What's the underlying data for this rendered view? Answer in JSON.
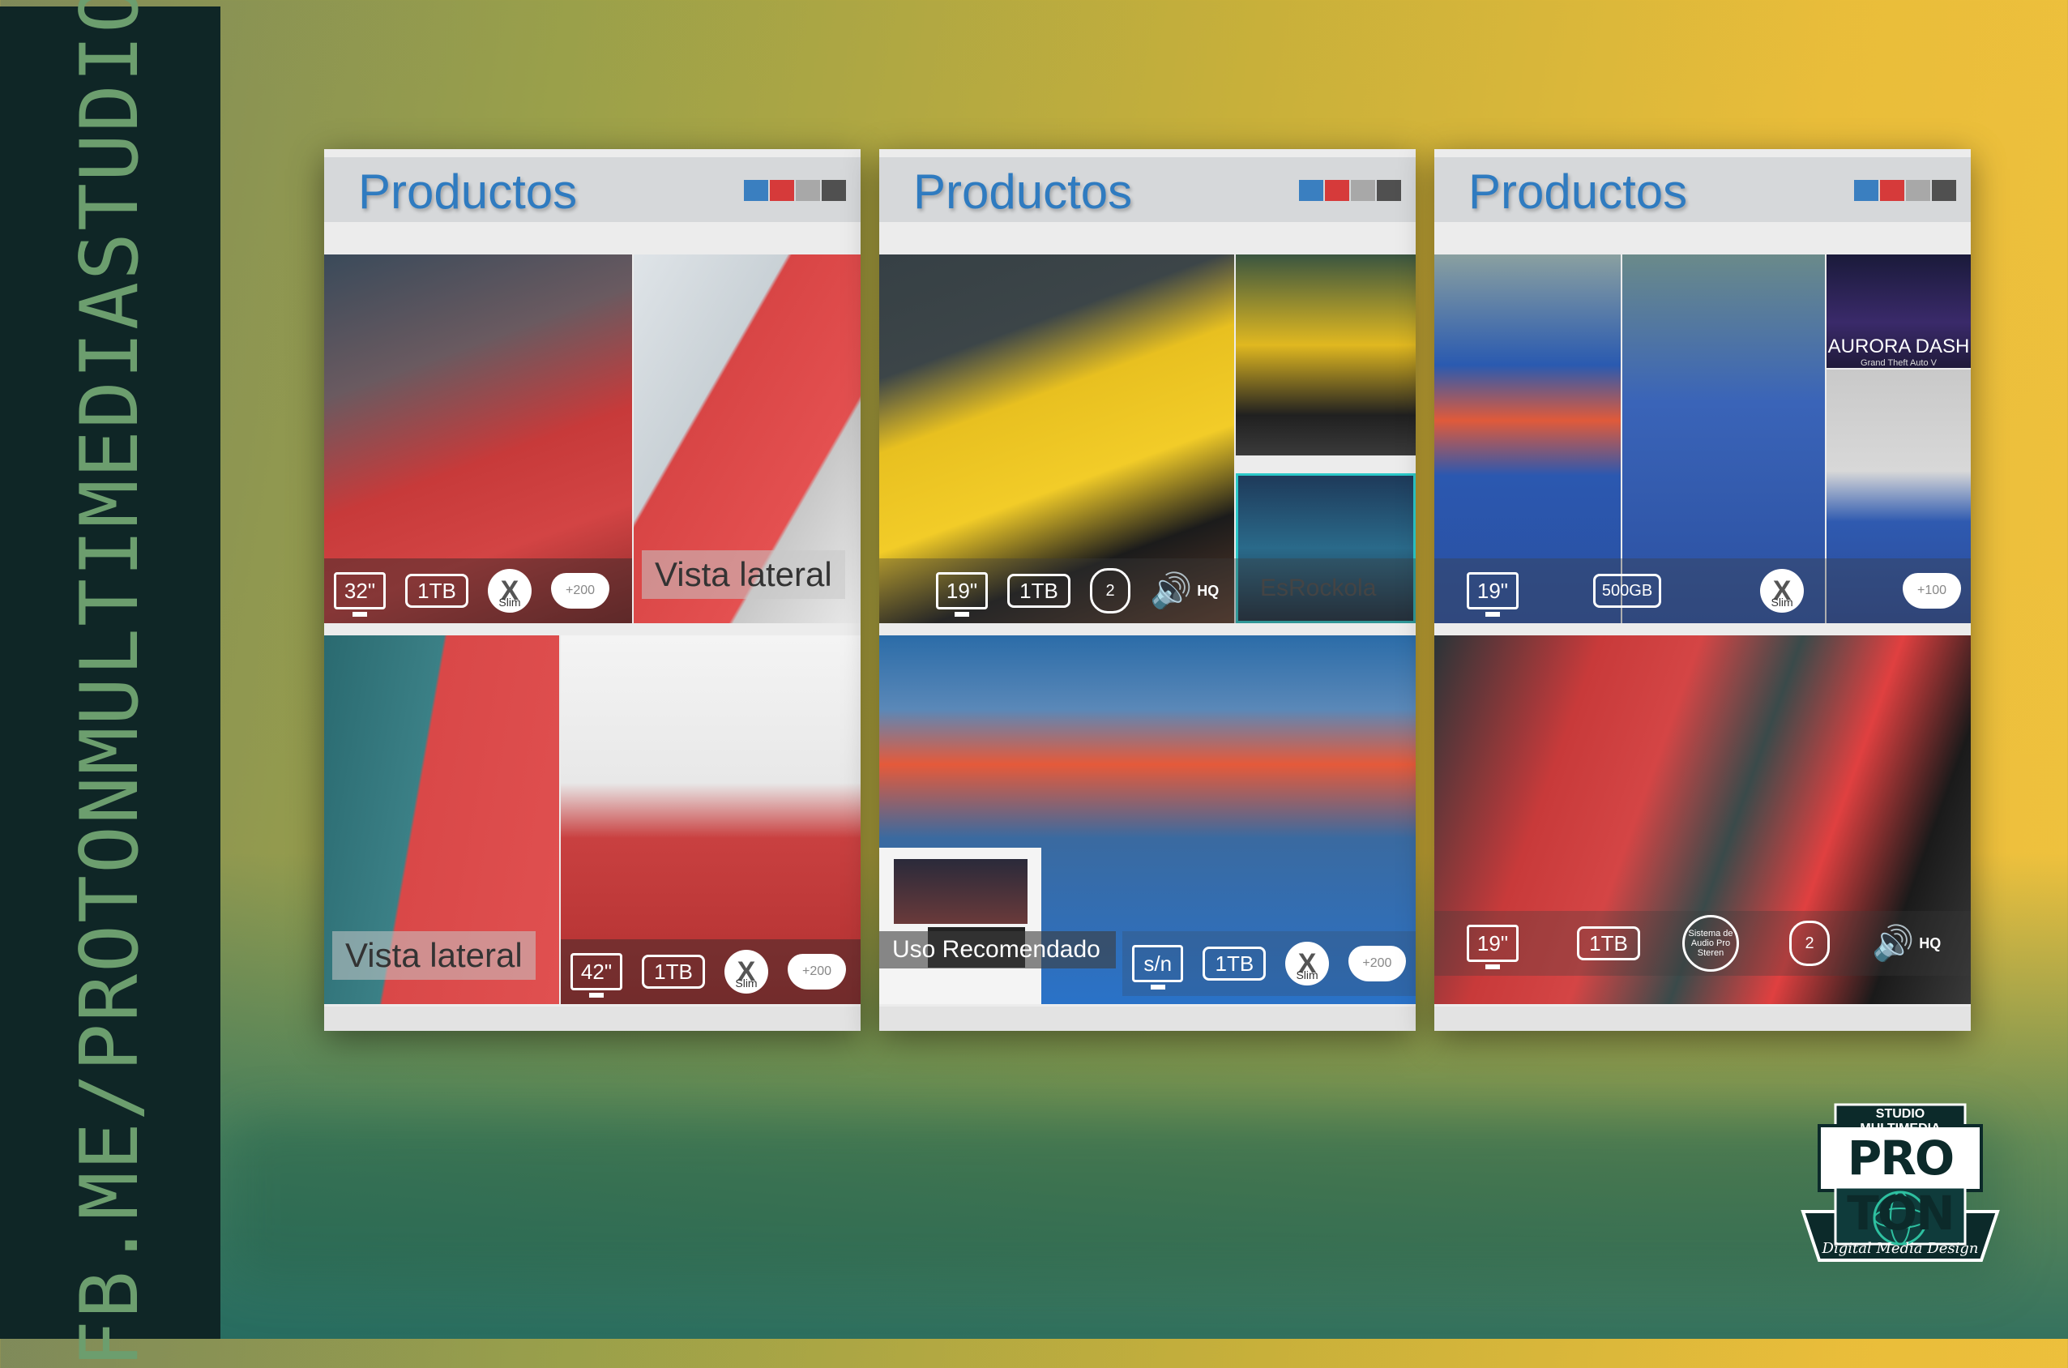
{
  "sidebar": {
    "url_text": "FB.ME/PROTONMULTIMEDIASTUDIO"
  },
  "colors": {
    "title": "#2f7bc0",
    "bar": [
      "#3a7fc0",
      "#d63a3a",
      "#a8a8a8",
      "#505050"
    ]
  },
  "panels": [
    {
      "title": "Productos",
      "top_left": {
        "icons": {
          "screen": "32\"",
          "storage": "1TB",
          "console": "Slim",
          "games": "+200"
        }
      },
      "top_right": {
        "label": "Vista lateral"
      },
      "bottom_left": {
        "label": "Vista lateral"
      },
      "bottom_right": {
        "icons": {
          "screen": "42\"",
          "storage": "1TB",
          "console": "Slim",
          "games": "+200"
        }
      }
    },
    {
      "title": "Productos",
      "top": {
        "icons": {
          "screen": "19\"",
          "storage": "1TB",
          "mic": "2",
          "audio": "HQ"
        },
        "label": "EsRockola"
      },
      "bottom": {
        "label": "Uso Recomendado",
        "icons": {
          "screen": "s/n",
          "storage": "1TB",
          "console": "Slim",
          "games": "+200"
        }
      }
    },
    {
      "title": "Productos",
      "top": {
        "icons": {
          "screen": "19\"",
          "storage": "500GB",
          "console": "Slim",
          "games": "+100"
        },
        "aurora_title": "AURORA DASH",
        "aurora_sub": "Grand Theft Auto V"
      },
      "bottom": {
        "icons": {
          "screen": "19\"",
          "storage": "1TB",
          "audio_system": "Sistema de Audio Pro Steren",
          "mic": "2",
          "audio": "HQ"
        }
      }
    }
  ],
  "logo": {
    "top_text": "STUDIO MULTIMEDIA",
    "main_text": "PRO TON",
    "bottom_text": "Digital Media Design"
  }
}
